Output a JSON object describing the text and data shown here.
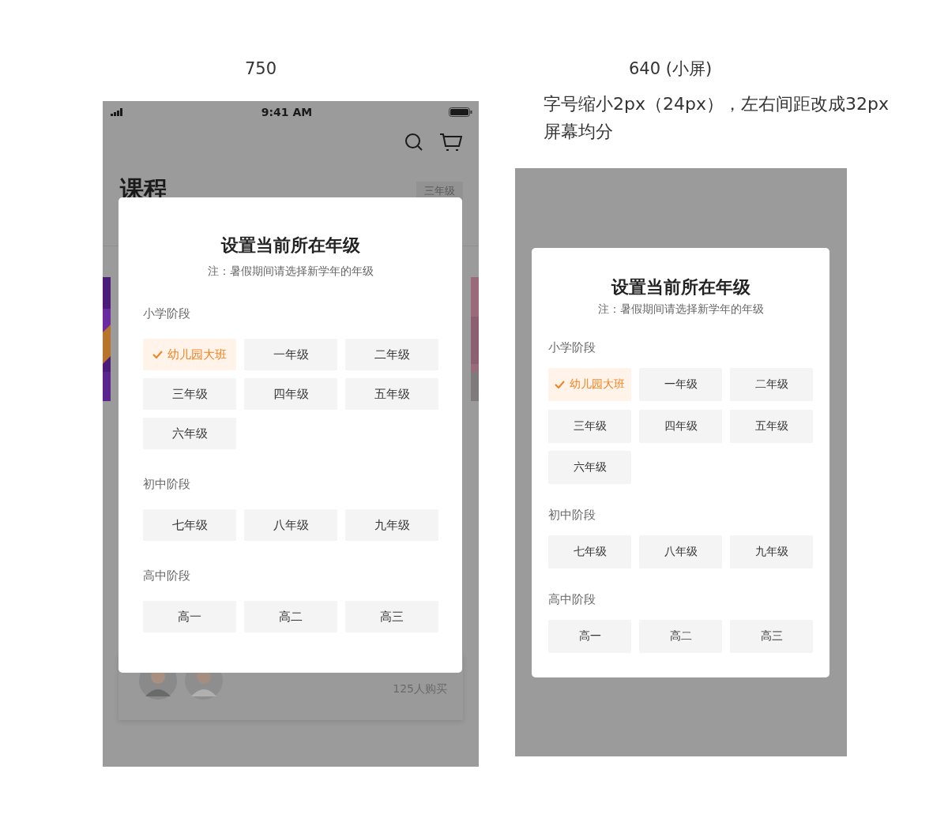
{
  "large_screen": {
    "heading": "750",
    "status_bar": {
      "time": "9:41 AM"
    },
    "page_title": "课程",
    "grade_tag": "三年级",
    "buyers": "125人购买",
    "dialog": {
      "title": "设置当前所在年级",
      "note": "注：暑假期间请选择新学年的年级",
      "sections": [
        {
          "label": "小学阶段",
          "options": [
            {
              "label": "幼儿园大班",
              "selected": true
            },
            {
              "label": "一年级",
              "selected": false
            },
            {
              "label": "二年级",
              "selected": false
            },
            {
              "label": "三年级",
              "selected": false
            },
            {
              "label": "四年级",
              "selected": false
            },
            {
              "label": "五年级",
              "selected": false
            },
            {
              "label": "六年级",
              "selected": false
            }
          ]
        },
        {
          "label": "初中阶段",
          "options": [
            {
              "label": "七年级",
              "selected": false
            },
            {
              "label": "八年级",
              "selected": false
            },
            {
              "label": "九年级",
              "selected": false
            }
          ]
        },
        {
          "label": "高中阶段",
          "options": [
            {
              "label": "高一",
              "selected": false
            },
            {
              "label": "高二",
              "selected": false
            },
            {
              "label": "高三",
              "selected": false
            }
          ]
        }
      ]
    }
  },
  "small_screen": {
    "heading": "640 (小屏)",
    "notes": [
      "字号缩小2px（24px），左右间距改成32px",
      "屏幕均分"
    ],
    "dialog": {
      "title": "设置当前所在年级",
      "note": "注：暑假期间请选择新学年的年级",
      "sections": [
        {
          "label": "小学阶段",
          "options": [
            {
              "label": "幼儿园大班",
              "selected": true
            },
            {
              "label": "一年级",
              "selected": false
            },
            {
              "label": "二年级",
              "selected": false
            },
            {
              "label": "三年级",
              "selected": false
            },
            {
              "label": "四年级",
              "selected": false
            },
            {
              "label": "五年级",
              "selected": false
            },
            {
              "label": "六年级",
              "selected": false
            }
          ]
        },
        {
          "label": "初中阶段",
          "options": [
            {
              "label": "七年级",
              "selected": false
            },
            {
              "label": "八年级",
              "selected": false
            },
            {
              "label": "九年级",
              "selected": false
            }
          ]
        },
        {
          "label": "高中阶段",
          "options": [
            {
              "label": "高一",
              "selected": false
            },
            {
              "label": "高二",
              "selected": false
            },
            {
              "label": "高三",
              "selected": false
            }
          ]
        }
      ]
    }
  }
}
